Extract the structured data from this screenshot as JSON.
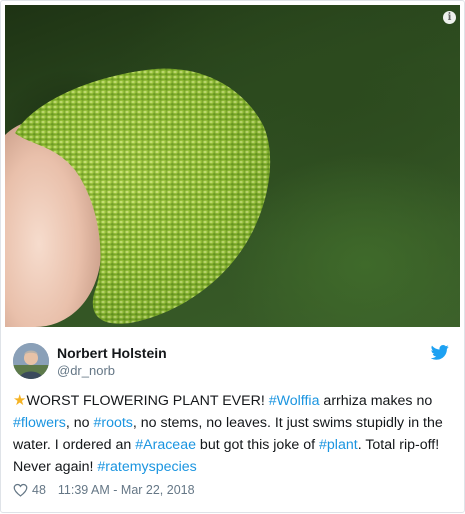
{
  "tweet": {
    "author_name": "Norbert Holstein",
    "author_handle": "@dr_norb",
    "text_parts": [
      {
        "kind": "text",
        "value": "WORST FLOWERING PLANT EVER! "
      },
      {
        "kind": "tag",
        "value": "#Wolffia"
      },
      {
        "kind": "text",
        "value": " arrhiza makes no "
      },
      {
        "kind": "tag",
        "value": "#flowers"
      },
      {
        "kind": "text",
        "value": ", no "
      },
      {
        "kind": "tag",
        "value": "#roots"
      },
      {
        "kind": "text",
        "value": ", no stems, no leaves. It just swims stupidly in the water. I ordered an "
      },
      {
        "kind": "tag",
        "value": "#Araceae"
      },
      {
        "kind": "text",
        "value": " but got this joke of "
      },
      {
        "kind": "tag",
        "value": "#plant"
      },
      {
        "kind": "text",
        "value": ". Total rip-off! Never again! "
      },
      {
        "kind": "tag",
        "value": "#ratemyspecies"
      }
    ],
    "likes": "48",
    "timestamp": "11:39 AM - Mar 22, 2018"
  },
  "icons": {
    "star": "star-icon",
    "info": "info-icon",
    "brand": "twitter-bird-icon",
    "like": "heart-icon"
  },
  "colors": {
    "hashtag": "#1b95e0",
    "brand_blue": "#1da1f2",
    "muted": "#657786",
    "star": "#f5b324"
  }
}
